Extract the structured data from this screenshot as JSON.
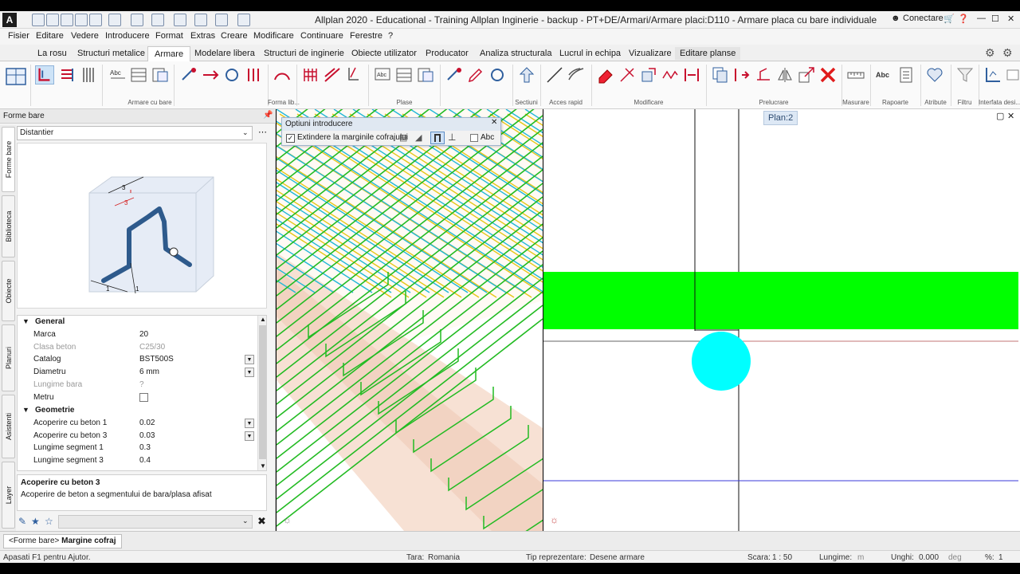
{
  "window": {
    "title": "Allplan 2020 - Educational - Training Allplan Inginerie - backup - PT+DE/Armari/Armare placi:D110 - Armare placa cu bare individuale",
    "app_icon": "A",
    "connect_label": "Conectare"
  },
  "menu": [
    "Fisier",
    "Editare",
    "Vedere",
    "Introducere",
    "Format",
    "Extras",
    "Creare",
    "Modificare",
    "Continuare",
    "Ferestre",
    "?"
  ],
  "tabs": [
    {
      "label": "La rosu"
    },
    {
      "label": "Structuri metalice"
    },
    {
      "label": "Armare",
      "active": true
    },
    {
      "label": "Modelare libera"
    },
    {
      "label": "Structuri de inginerie"
    },
    {
      "label": "Obiecte utilizator"
    },
    {
      "label": "Producator"
    },
    {
      "label": "Analiza structurala"
    },
    {
      "label": "Lucrul in echipa"
    },
    {
      "label": "Vizualizare"
    },
    {
      "label": "Editare planse"
    }
  ],
  "ribbon_groups": [
    "Armare cu bare",
    "Forma lib...",
    "Plase",
    "Sectiuni",
    "Acces rapid",
    "Modificare",
    "Prelucrare",
    "Masurare",
    "Rapoarte",
    "Atribute",
    "Filtru",
    "Interfata desi..."
  ],
  "ribbon_labels": {
    "abc": "Abc"
  },
  "left_panel": {
    "title": "Forme bare",
    "dropdown_value": "Distantier",
    "side_tabs": [
      "Forme bare",
      "Biblioteca",
      "Obiecte",
      "Planuri",
      "Asistenti",
      "Layer"
    ],
    "sections": {
      "general": "General",
      "geometry": "Geometrie"
    },
    "props": {
      "marca": {
        "label": "Marca",
        "value": "20"
      },
      "clasa_beton": {
        "label": "Clasa beton",
        "value": "C25/30"
      },
      "catalog": {
        "label": "Catalog",
        "value": "BST500S"
      },
      "diametru": {
        "label": "Diametru",
        "value": "6 mm"
      },
      "lungime_bara": {
        "label": "Lungime bara",
        "value": "?"
      },
      "metru": {
        "label": "Metru",
        "value": ""
      },
      "acoperire1": {
        "label": "Acoperire cu beton 1",
        "value": "0.02"
      },
      "acoperire3": {
        "label": "Acoperire cu beton 3",
        "value": "0.03"
      },
      "segment1": {
        "label": "Lungime segment 1",
        "value": "0.3"
      },
      "segment3": {
        "label": "Lungime segment 3",
        "value": "0.4"
      }
    },
    "help": {
      "title": "Acoperire cu beton 3",
      "text": "Acoperire de beton a segmentului de bara/plasa afisat"
    },
    "preview_labels": {
      "a": "3",
      "b": "3",
      "c": "1",
      "d": "1"
    }
  },
  "options_dialog": {
    "title": "Optiuni introducere",
    "checkbox_label": "Extindere la marginile cofrajului",
    "abc_label": "Abc"
  },
  "viewport2d": {
    "plan_label": "Plan:2"
  },
  "breadcrumb": {
    "back": "<Forme bare>",
    "current": "Margine cofraj"
  },
  "status": {
    "help": "Apasati F1 pentru Ajutor.",
    "tara_label": "Tara:",
    "tara_value": "Romania",
    "tip_label": "Tip reprezentare:",
    "tip_value": "Desene armare",
    "scara_label": "Scara:",
    "scara_value": "1 : 50",
    "lungime_label": "Lungime:",
    "lungime_value": "m",
    "unghi_label": "Unghi:",
    "unghi_value": "0.000",
    "unghi_unit": "deg",
    "percent_label": "%:",
    "percent_value": "1"
  },
  "colors": {
    "accent": "#1e73be",
    "rebar_green": "#22bb22",
    "rebar_cyan": "#22b7d8",
    "rebar_yellow": "#e6c619",
    "slab_green": "#00ff00",
    "circle_cyan": "#00ffff"
  }
}
